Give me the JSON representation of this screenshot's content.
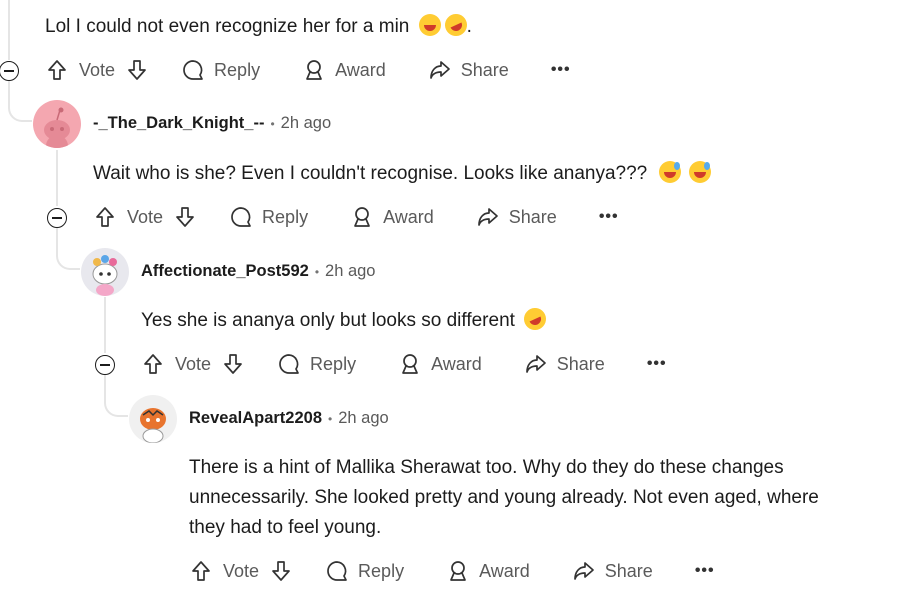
{
  "comments": [
    {
      "username": "",
      "time": "",
      "body": "Lol I could not even recognize her for a min",
      "body_suffix": ".",
      "emojis": [
        "joy-emoji",
        "rofl-emoji"
      ]
    },
    {
      "username": "-_The_Dark_Knight_--",
      "time": "2h ago",
      "body": "Wait who is she? Even I couldn't recognise. Looks like ananya???",
      "emojis": [
        "sweat-smile-emoji",
        "sweat-smile-emoji"
      ]
    },
    {
      "username": "Affectionate_Post592",
      "time": "2h ago",
      "body": "Yes she is ananya only but looks so different",
      "emojis": [
        "rofl-emoji"
      ]
    },
    {
      "username": "RevealApart2208",
      "time": "2h ago",
      "body_lines": [
        "There is a hint of Mallika Sherawat too. Why do they do these changes",
        "unnecessarily. She looked pretty and young already. Not even aged, where",
        "they had to feel young."
      ]
    }
  ],
  "actions": {
    "vote": "Vote",
    "reply": "Reply",
    "award": "Award",
    "share": "Share",
    "more": "•••"
  },
  "meta_separator": "•",
  "colors": {
    "text": "#1c1c1c",
    "muted": "#5a5a5a",
    "thread_line": "#e5e5e5",
    "avatar_pink": "#f4a7b0",
    "emoji_yellow": "#ffcc33"
  }
}
